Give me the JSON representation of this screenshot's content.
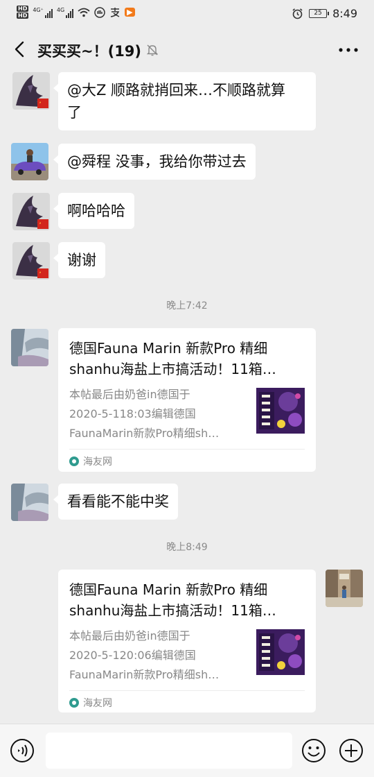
{
  "status_bar": {
    "hd1": "HD",
    "hd2": "HD",
    "net1": "4G⁺",
    "net2": "4G",
    "battery": "25",
    "time": "8:49",
    "icons": [
      "wifi-icon",
      "shield-hand-icon",
      "alipay-icon",
      "media-icon",
      "alarm-icon"
    ]
  },
  "header": {
    "title": "买买买~！(19)",
    "back_icon": "chevron-left-icon",
    "mute_icon": "bell-off-icon",
    "more_icon": "more-dots-icon"
  },
  "messages": [
    {
      "type": "text",
      "side": "left",
      "avatar": "dragon-avatar",
      "lines": [
        "@大Z  顺路就捎回来…不顺路就算",
        "了"
      ]
    },
    {
      "type": "text",
      "side": "left",
      "avatar": "car-avatar",
      "lines": [
        "@舜程  没事，我给你带过去"
      ]
    },
    {
      "type": "text",
      "side": "left",
      "avatar": "dragon-avatar",
      "lines": [
        "啊哈哈哈"
      ]
    },
    {
      "type": "text",
      "side": "left",
      "avatar": "dragon-avatar",
      "lines": [
        "谢谢"
      ]
    },
    {
      "type": "time",
      "text": "晚上7:42"
    },
    {
      "type": "link",
      "side": "left",
      "avatar": "blur-avatar",
      "title": [
        "德国Fauna Marin 新款Pro 精细",
        "shanhu海盐上市搞活动！11箱…"
      ],
      "desc": [
        "本帖最后由奶爸in德国于",
        "2020-5-118:03编辑德国",
        "FaunaMarin新款Pro精细sh…"
      ],
      "source": "海友网"
    },
    {
      "type": "text",
      "side": "left",
      "avatar": "blur-avatar",
      "lines": [
        "看看能不能中奖"
      ]
    },
    {
      "type": "time",
      "text": "晚上8:49"
    },
    {
      "type": "link",
      "side": "right",
      "avatar": "street-avatar",
      "title": [
        "德国Fauna Marin 新款Pro 精细",
        "shanhu海盐上市搞活动！11箱…"
      ],
      "desc": [
        "本帖最后由奶爸in德国于",
        "2020-5-120:06编辑德国",
        "FaunaMarin新款Pro精细sh…"
      ],
      "source": "海友网"
    }
  ],
  "input_bar": {
    "placeholder": "",
    "voice_icon": "voice-icon",
    "emoji_icon": "emoji-icon",
    "plus_icon": "plus-icon"
  },
  "colors": {
    "background": "#ededed",
    "bubble": "#ffffff",
    "text": "#111111",
    "muted": "#888888"
  }
}
